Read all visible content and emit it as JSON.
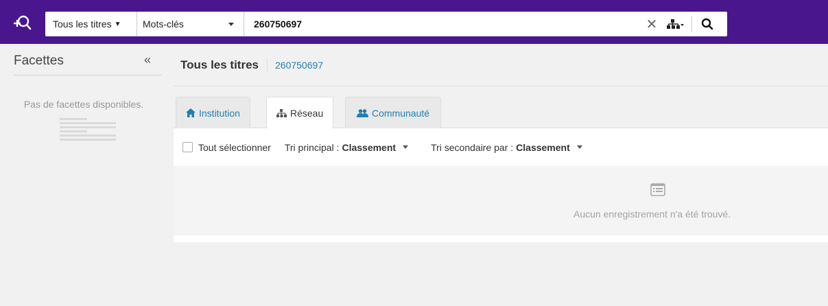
{
  "header": {
    "logo_icon": "library-search-logo-icon",
    "scope_label": "Tous les titres",
    "field_label": "Mots-clés",
    "query_value": "260750697",
    "clear_icon": "close-icon",
    "network_icon": "network-icon",
    "search_icon": "search-icon",
    "bar_color": "#4a168e"
  },
  "facets": {
    "title": "Facettes",
    "collapse_glyph": "«",
    "empty_text": "Pas de facettes disponibles."
  },
  "main": {
    "title": "Tous les titres",
    "subtitle": "260750697",
    "tabs": [
      {
        "label": "Institution",
        "icon": "home-icon",
        "active": false
      },
      {
        "label": "Réseau",
        "icon": "network-icon",
        "active": true
      },
      {
        "label": "Communauté",
        "icon": "users-icon",
        "active": false
      }
    ],
    "toolbar": {
      "select_all": "Tout sélectionner",
      "primary_sort_label": "Tri principal :",
      "primary_sort_value": "Classement",
      "secondary_sort_label": "Tri secondaire par :",
      "secondary_sort_value": "Classement"
    },
    "empty_message": "Aucun enregistrement n'a été trouvé."
  }
}
